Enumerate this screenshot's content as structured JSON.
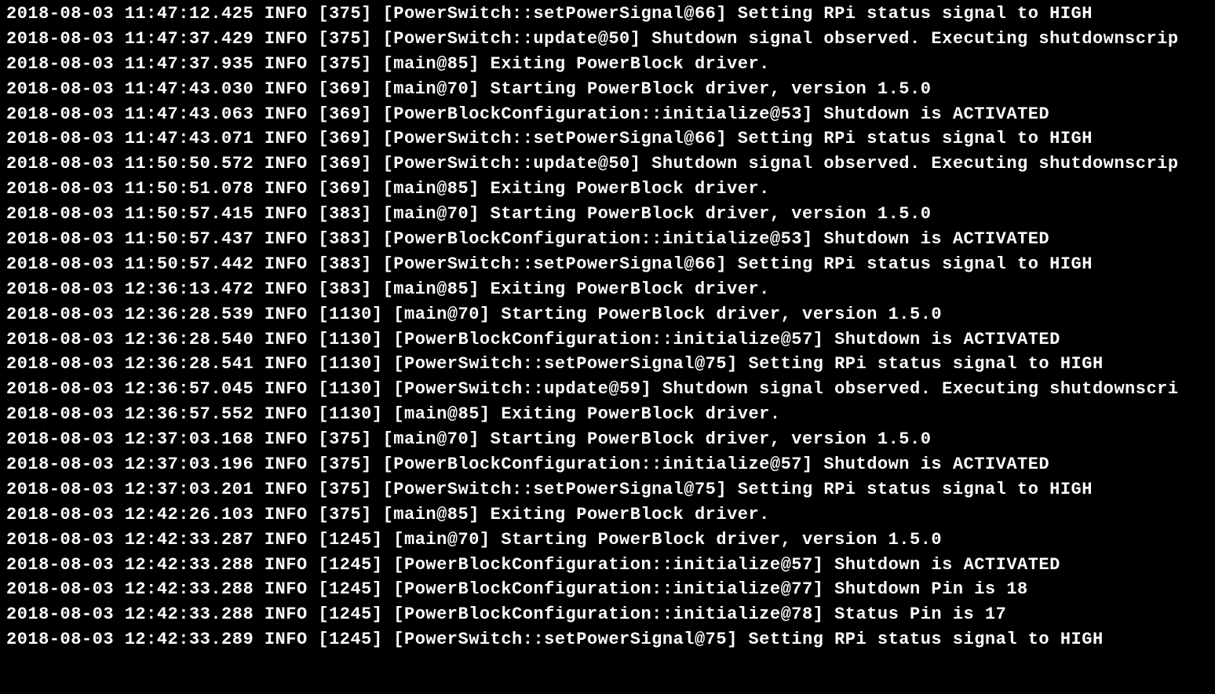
{
  "log_lines": [
    {
      "timestamp": "2018-08-03 11:47:12.425",
      "level": "INFO",
      "pid": "[375]",
      "source": "[PowerSwitch::setPowerSignal@66]",
      "message": "Setting RPi status signal to HIGH"
    },
    {
      "timestamp": "2018-08-03 11:47:37.429",
      "level": "INFO",
      "pid": "[375]",
      "source": "[PowerSwitch::update@50]",
      "message": "Shutdown signal observed. Executing shutdownscrip"
    },
    {
      "timestamp": "2018-08-03 11:47:37.935",
      "level": "INFO",
      "pid": "[375]",
      "source": "[main@85]",
      "message": "Exiting PowerBlock driver."
    },
    {
      "timestamp": "2018-08-03 11:47:43.030",
      "level": "INFO",
      "pid": "[369]",
      "source": "[main@70]",
      "message": "Starting PowerBlock driver, version 1.5.0"
    },
    {
      "timestamp": "2018-08-03 11:47:43.063",
      "level": "INFO",
      "pid": "[369]",
      "source": "[PowerBlockConfiguration::initialize@53]",
      "message": "Shutdown is ACTIVATED"
    },
    {
      "timestamp": "2018-08-03 11:47:43.071",
      "level": "INFO",
      "pid": "[369]",
      "source": "[PowerSwitch::setPowerSignal@66]",
      "message": "Setting RPi status signal to HIGH"
    },
    {
      "timestamp": "2018-08-03 11:50:50.572",
      "level": "INFO",
      "pid": "[369]",
      "source": "[PowerSwitch::update@50]",
      "message": "Shutdown signal observed. Executing shutdownscrip"
    },
    {
      "timestamp": "2018-08-03 11:50:51.078",
      "level": "INFO",
      "pid": "[369]",
      "source": "[main@85]",
      "message": "Exiting PowerBlock driver."
    },
    {
      "timestamp": "2018-08-03 11:50:57.415",
      "level": "INFO",
      "pid": "[383]",
      "source": "[main@70]",
      "message": "Starting PowerBlock driver, version 1.5.0"
    },
    {
      "timestamp": "2018-08-03 11:50:57.437",
      "level": "INFO",
      "pid": "[383]",
      "source": "[PowerBlockConfiguration::initialize@53]",
      "message": "Shutdown is ACTIVATED"
    },
    {
      "timestamp": "2018-08-03 11:50:57.442",
      "level": "INFO",
      "pid": "[383]",
      "source": "[PowerSwitch::setPowerSignal@66]",
      "message": "Setting RPi status signal to HIGH"
    },
    {
      "timestamp": "2018-08-03 12:36:13.472",
      "level": "INFO",
      "pid": "[383]",
      "source": "[main@85]",
      "message": "Exiting PowerBlock driver."
    },
    {
      "timestamp": "2018-08-03 12:36:28.539",
      "level": "INFO",
      "pid": "[1130]",
      "source": "[main@70]",
      "message": "Starting PowerBlock driver, version 1.5.0"
    },
    {
      "timestamp": "2018-08-03 12:36:28.540",
      "level": "INFO",
      "pid": "[1130]",
      "source": "[PowerBlockConfiguration::initialize@57]",
      "message": "Shutdown is ACTIVATED"
    },
    {
      "timestamp": "2018-08-03 12:36:28.541",
      "level": "INFO",
      "pid": "[1130]",
      "source": "[PowerSwitch::setPowerSignal@75]",
      "message": "Setting RPi status signal to HIGH"
    },
    {
      "timestamp": "2018-08-03 12:36:57.045",
      "level": "INFO",
      "pid": "[1130]",
      "source": "[PowerSwitch::update@59]",
      "message": "Shutdown signal observed. Executing shutdownscri"
    },
    {
      "timestamp": "2018-08-03 12:36:57.552",
      "level": "INFO",
      "pid": "[1130]",
      "source": "[main@85]",
      "message": "Exiting PowerBlock driver."
    },
    {
      "timestamp": "2018-08-03 12:37:03.168",
      "level": "INFO",
      "pid": "[375]",
      "source": "[main@70]",
      "message": "Starting PowerBlock driver, version 1.5.0"
    },
    {
      "timestamp": "2018-08-03 12:37:03.196",
      "level": "INFO",
      "pid": "[375]",
      "source": "[PowerBlockConfiguration::initialize@57]",
      "message": "Shutdown is ACTIVATED"
    },
    {
      "timestamp": "2018-08-03 12:37:03.201",
      "level": "INFO",
      "pid": "[375]",
      "source": "[PowerSwitch::setPowerSignal@75]",
      "message": "Setting RPi status signal to HIGH"
    },
    {
      "timestamp": "2018-08-03 12:42:26.103",
      "level": "INFO",
      "pid": "[375]",
      "source": "[main@85]",
      "message": "Exiting PowerBlock driver."
    },
    {
      "timestamp": "2018-08-03 12:42:33.287",
      "level": "INFO",
      "pid": "[1245]",
      "source": "[main@70]",
      "message": "Starting PowerBlock driver, version 1.5.0"
    },
    {
      "timestamp": "2018-08-03 12:42:33.288",
      "level": "INFO",
      "pid": "[1245]",
      "source": "[PowerBlockConfiguration::initialize@57]",
      "message": "Shutdown is ACTIVATED"
    },
    {
      "timestamp": "2018-08-03 12:42:33.288",
      "level": "INFO",
      "pid": "[1245]",
      "source": "[PowerBlockConfiguration::initialize@77]",
      "message": "Shutdown Pin is 18"
    },
    {
      "timestamp": "2018-08-03 12:42:33.288",
      "level": "INFO",
      "pid": "[1245]",
      "source": "[PowerBlockConfiguration::initialize@78]",
      "message": "Status Pin is 17"
    },
    {
      "timestamp": "2018-08-03 12:42:33.289",
      "level": "INFO",
      "pid": "[1245]",
      "source": "[PowerSwitch::setPowerSignal@75]",
      "message": "Setting RPi status signal to HIGH"
    }
  ]
}
